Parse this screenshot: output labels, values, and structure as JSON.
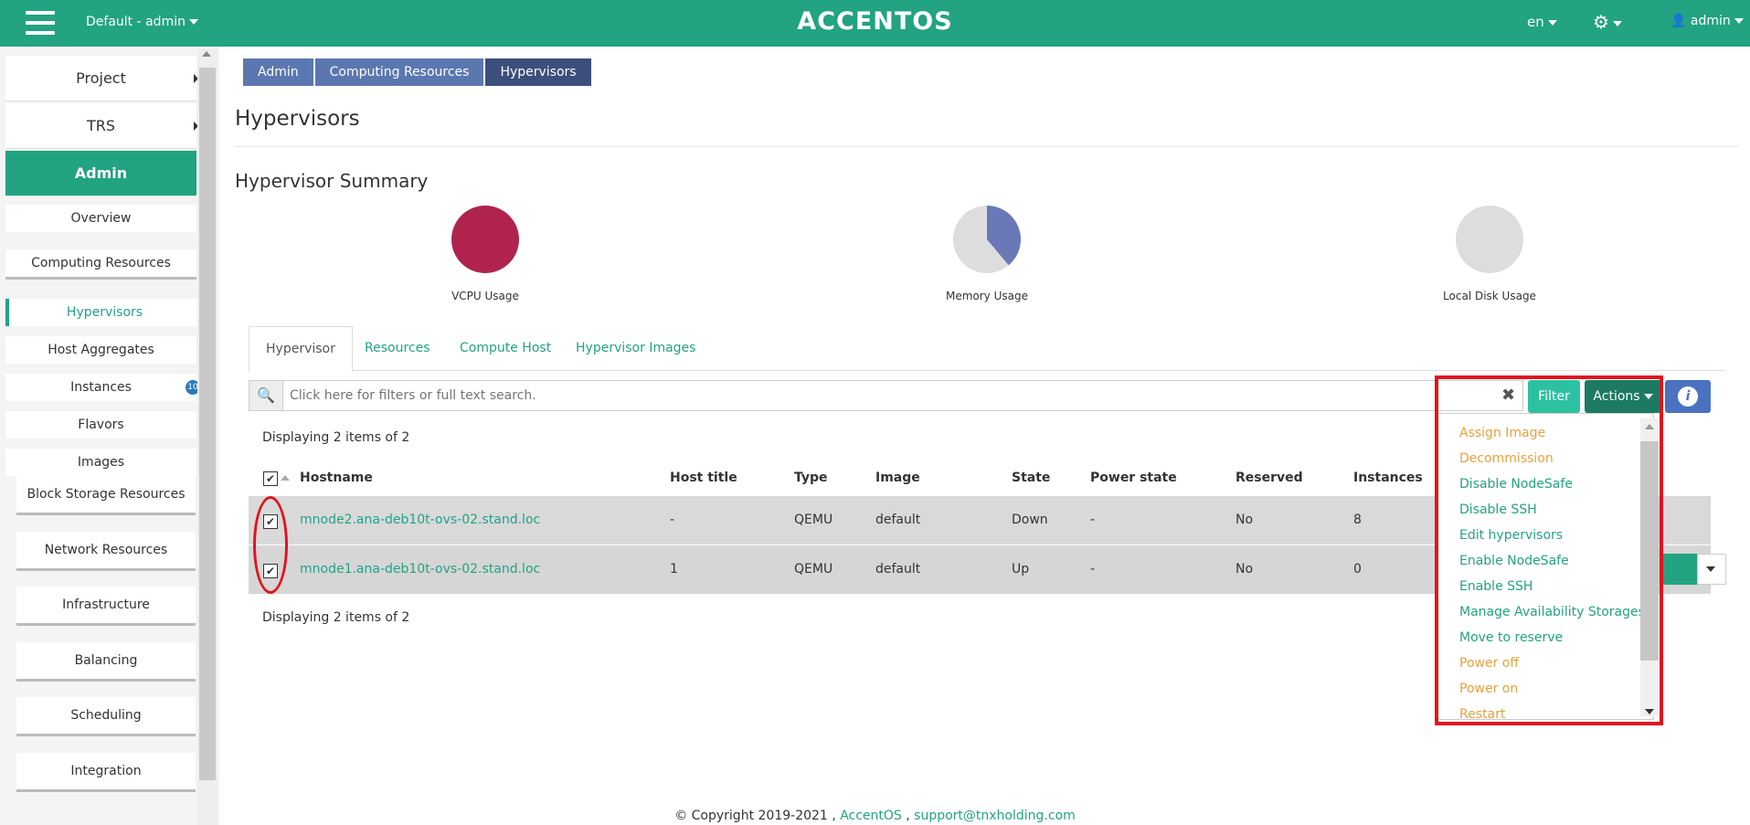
{
  "topbar": {
    "project_selector": "Default - admin",
    "logo": "ACCENTOS",
    "language": "en",
    "user": "admin"
  },
  "sidebar": {
    "major": [
      {
        "label": "Project"
      },
      {
        "label": "TRS"
      },
      {
        "label": "Admin"
      }
    ],
    "admin_items": [
      {
        "label": "Overview"
      },
      {
        "label": "Computing Resources"
      },
      {
        "label": "Hypervisors"
      },
      {
        "label": "Host Aggregates"
      },
      {
        "label": "Instances",
        "badge": "10"
      },
      {
        "label": "Flavors"
      },
      {
        "label": "Images"
      }
    ],
    "sections": [
      {
        "label": "Block Storage Resources"
      },
      {
        "label": "Network Resources"
      },
      {
        "label": "Infrastructure"
      },
      {
        "label": "Balancing"
      },
      {
        "label": "Scheduling"
      },
      {
        "label": "Integration"
      }
    ]
  },
  "breadcrumb": [
    "Admin",
    "Computing Resources",
    "Hypervisors"
  ],
  "page_title": "Hypervisors",
  "summary": {
    "title": "Hypervisor Summary",
    "charts": [
      {
        "label": "VCPU Usage",
        "used_fraction": 1.0,
        "color": "#b0234f"
      },
      {
        "label": "Memory Usage",
        "used_fraction": 0.39,
        "color": "#6a78b7"
      },
      {
        "label": "Local Disk Usage",
        "used_fraction": 0.0,
        "color": "#dddddd"
      }
    ]
  },
  "tabs": [
    "Hypervisor",
    "Resources",
    "Compute Host",
    "Hypervisor Images"
  ],
  "search": {
    "placeholder": "Click here for filters or full text search."
  },
  "buttons": {
    "filter": "Filter",
    "actions": "Actions"
  },
  "table": {
    "displaying": "Displaying 2 items of 2",
    "columns": [
      "Hostname",
      "Host title",
      "Type",
      "Image",
      "State",
      "Power state",
      "Reserved",
      "Instances"
    ],
    "rows": [
      {
        "hostname": "mnode2.ana-deb10t-ovs-02.stand.loc",
        "host_title": "-",
        "type": "QEMU",
        "image": "default",
        "state": "Down",
        "power_state": "-",
        "reserved": "No",
        "instances": "8"
      },
      {
        "hostname": "mnode1.ana-deb10t-ovs-02.stand.loc",
        "host_title": "1",
        "type": "QEMU",
        "image": "default",
        "state": "Up",
        "power_state": "-",
        "reserved": "No",
        "instances": "0"
      }
    ]
  },
  "actions_menu": [
    {
      "label": "Assign Image",
      "color": "#e8a13a"
    },
    {
      "label": "Decommission",
      "color": "#e8a13a"
    },
    {
      "label": "Disable NodeSafe",
      "color": "#22a382"
    },
    {
      "label": "Disable SSH",
      "color": "#22a382"
    },
    {
      "label": "Edit hypervisors",
      "color": "#22a382"
    },
    {
      "label": "Enable NodeSafe",
      "color": "#22a382"
    },
    {
      "label": "Enable SSH",
      "color": "#22a382"
    },
    {
      "label": "Manage Availability Storages",
      "color": "#22a382"
    },
    {
      "label": "Move to reserve",
      "color": "#22a382"
    },
    {
      "label": "Power off",
      "color": "#e8a13a"
    },
    {
      "label": "Power on",
      "color": "#e8a13a"
    },
    {
      "label": "Restart",
      "color": "#e8a13a"
    }
  ],
  "footer": {
    "copyright": "© Copyright 2019-2021 ,",
    "brand": "AccentOS",
    "sep": ",",
    "email": "support@tnxholding.com"
  },
  "colors": {
    "accent": "#22a382",
    "breadcrumb": "#5a77b0",
    "annotation": "#e0141e"
  }
}
